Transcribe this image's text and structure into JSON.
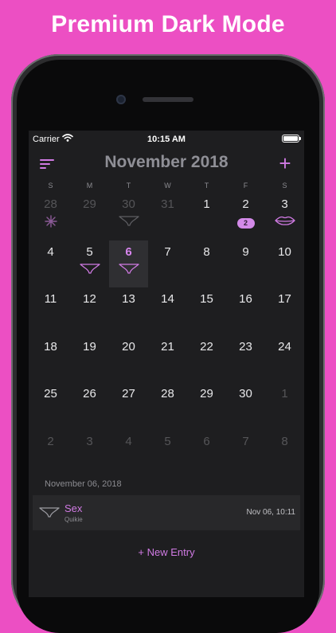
{
  "headline": "Premium Dark Mode",
  "status_bar": {
    "carrier": "Carrier",
    "time": "10:15 AM"
  },
  "navbar": {
    "title": "November 2018",
    "add_label": "+"
  },
  "weekdays": [
    "S",
    "M",
    "T",
    "W",
    "T",
    "F",
    "S"
  ],
  "calendar": {
    "weeks": [
      [
        {
          "d": "28",
          "other": true,
          "mark": "flower"
        },
        {
          "d": "29",
          "other": true
        },
        {
          "d": "30",
          "other": true,
          "mark": "panties-dim"
        },
        {
          "d": "31",
          "other": true
        },
        {
          "d": "1"
        },
        {
          "d": "2",
          "mark": "badge",
          "badge": "2"
        },
        {
          "d": "3",
          "mark": "lips"
        }
      ],
      [
        {
          "d": "4"
        },
        {
          "d": "5",
          "mark": "panties"
        },
        {
          "d": "6",
          "today": true,
          "selected": true,
          "mark": "panties"
        },
        {
          "d": "7"
        },
        {
          "d": "8"
        },
        {
          "d": "9"
        },
        {
          "d": "10"
        }
      ],
      [
        {
          "d": "11"
        },
        {
          "d": "12"
        },
        {
          "d": "13"
        },
        {
          "d": "14"
        },
        {
          "d": "15"
        },
        {
          "d": "16"
        },
        {
          "d": "17"
        }
      ],
      [
        {
          "d": "18"
        },
        {
          "d": "19"
        },
        {
          "d": "20"
        },
        {
          "d": "21"
        },
        {
          "d": "22"
        },
        {
          "d": "23"
        },
        {
          "d": "24"
        }
      ],
      [
        {
          "d": "25"
        },
        {
          "d": "26"
        },
        {
          "d": "27"
        },
        {
          "d": "28"
        },
        {
          "d": "29"
        },
        {
          "d": "30"
        },
        {
          "d": "1",
          "other": true
        }
      ],
      [
        {
          "d": "2",
          "other": true
        },
        {
          "d": "3",
          "other": true
        },
        {
          "d": "4",
          "other": true
        },
        {
          "d": "5",
          "other": true
        },
        {
          "d": "6",
          "other": true
        },
        {
          "d": "7",
          "other": true
        },
        {
          "d": "8",
          "other": true
        }
      ]
    ]
  },
  "entries": {
    "date_label": "November 06, 2018",
    "items": [
      {
        "title": "Sex",
        "subtitle": "Quikie",
        "time": "Nov 06, 10:11",
        "icon": "panties-icon"
      }
    ]
  },
  "new_entry_label": "+ New Entry",
  "colors": {
    "background": "#ec4fc3",
    "screen": "#1e1e20",
    "accent": "#d07ae3",
    "muted": "#8b8b90"
  }
}
